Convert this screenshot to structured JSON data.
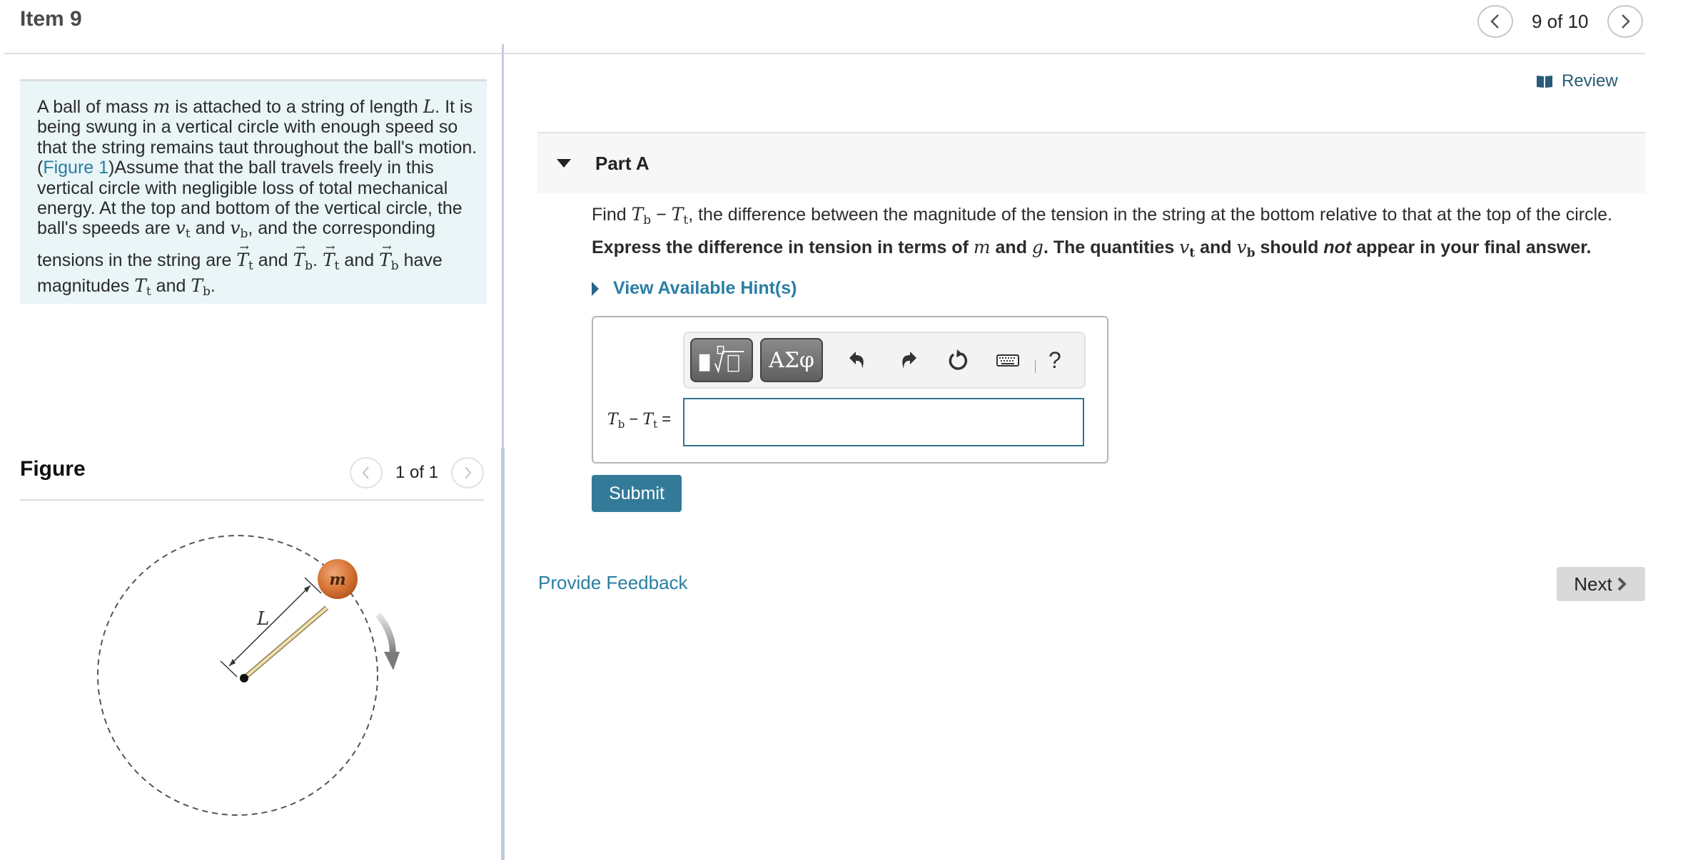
{
  "header": {
    "title": "Item 9",
    "pager": {
      "text": "9 of 10",
      "prev_icon": "chevron-left-icon",
      "next_icon": "chevron-right-icon"
    }
  },
  "problem": {
    "lines": [
      [
        "A ball of mass ",
        {
          "math": "m"
        },
        " is attached to a string of length ",
        {
          "math": "L"
        },
        ". It is"
      ],
      [
        "being swung in a vertical circle with enough speed so"
      ],
      [
        "that the string remains taut throughout the ball's motion."
      ],
      [
        "(",
        {
          "link": "Figure 1"
        },
        ")Assume that the ball travels freely in this"
      ],
      [
        "vertical circle with negligible loss of total mechanical"
      ],
      [
        "energy. At the top and bottom of the vertical circle, the"
      ],
      [
        "ball's speeds are ",
        {
          "math": "v",
          "sub": "t"
        },
        " and ",
        {
          "math": "v",
          "sub": "b"
        },
        ", and the corresponding"
      ],
      [
        "tensions in the string are ",
        {
          "vec": "T",
          "sub": "t"
        },
        " and ",
        {
          "vec": "T",
          "sub": "b"
        },
        ". ",
        {
          "vec": "T",
          "sub": "t"
        },
        " and ",
        {
          "vec": "T",
          "sub": "b"
        },
        " have"
      ],
      [
        "magnitudes ",
        {
          "math": "T",
          "sub": "t"
        },
        "  and ",
        {
          "math": "T",
          "sub": "b"
        },
        "."
      ]
    ]
  },
  "figure": {
    "title": "Figure",
    "pager_text": "1 of 1",
    "labels": {
      "mass": "m",
      "length": "L"
    }
  },
  "review": {
    "label": "Review",
    "icon": "book-icon"
  },
  "part": {
    "title": "Part A",
    "question": [
      "Find ",
      {
        "math": "T",
        "sub": "b"
      },
      " − ",
      {
        "math": "T",
        "sub": "t"
      },
      ", the difference between the magnitude of the tension in the string at the bottom relative to that at the top of the circle."
    ],
    "instruction": [
      "Express the difference in tension in terms of ",
      {
        "math": "m"
      },
      " and ",
      {
        "math": "g"
      },
      ". The quantities ",
      {
        "math": "v",
        "sub": "t"
      },
      " and ",
      {
        "math": "v",
        "sub": "b"
      },
      " should ",
      {
        "em": "not"
      },
      " appear in your final answer."
    ],
    "hint_label": "View Available Hint(s)",
    "toolbar": {
      "templates_label": "templates-button",
      "symbols_label": "ΑΣφ",
      "undo": "undo-icon",
      "redo": "redo-icon",
      "reset": "reset-icon",
      "keyboard": "keyboard-icon",
      "help": "?"
    },
    "answer": {
      "label_lhs": {
        "a": "T",
        "a_sub": "b",
        "minus": " − ",
        "b": "T",
        "b_sub": "t",
        "eq": " ="
      },
      "value": "",
      "placeholder": ""
    },
    "submit_label": "Submit"
  },
  "footer": {
    "feedback_label": "Provide Feedback",
    "next_label": "Next"
  },
  "colors": {
    "accent": "#2a7ea4",
    "submit_bg": "#337a99",
    "problem_bg": "#e9f5f7",
    "ball": "#d9783a"
  }
}
